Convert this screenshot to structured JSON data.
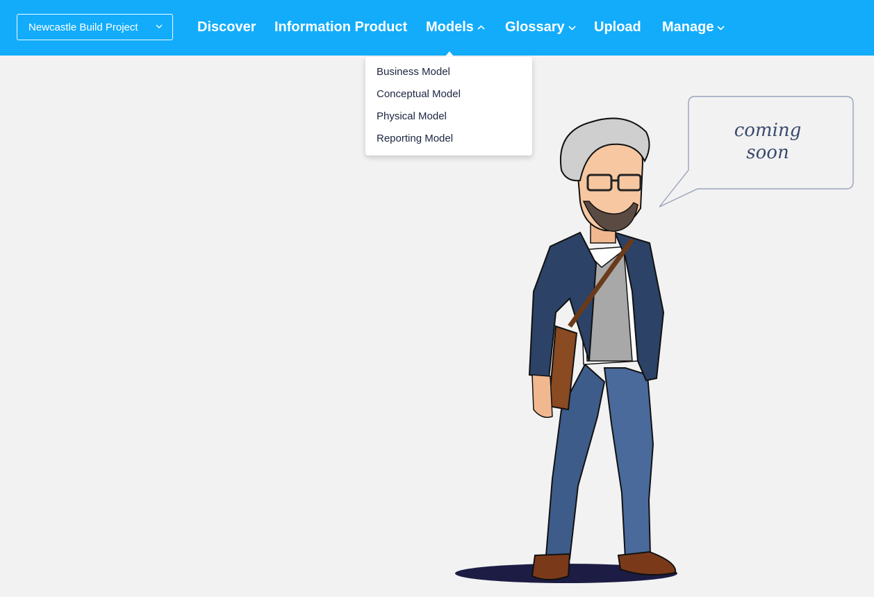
{
  "header": {
    "project_selector": {
      "value": "Newcastle Build Project"
    },
    "nav": [
      {
        "label": "Discover",
        "has_dropdown": false
      },
      {
        "label": "Information Product",
        "has_dropdown": false
      },
      {
        "label": "Models",
        "has_dropdown": true,
        "expanded": true
      },
      {
        "label": "Glossary",
        "has_dropdown": true,
        "expanded": false
      },
      {
        "label": "Upload",
        "has_dropdown": false
      },
      {
        "label": "Manage",
        "has_dropdown": true,
        "expanded": false
      }
    ]
  },
  "models_menu": {
    "items": [
      "Business Model",
      "Conceptual Model",
      "Physical Model",
      "Reporting Model"
    ]
  },
  "main": {
    "speech_bubble": {
      "line1": "coming",
      "line2": "soon"
    }
  },
  "colors": {
    "topbar": "#12acfb",
    "page_background": "#f2f2f2",
    "menu_text": "#1c2440"
  }
}
